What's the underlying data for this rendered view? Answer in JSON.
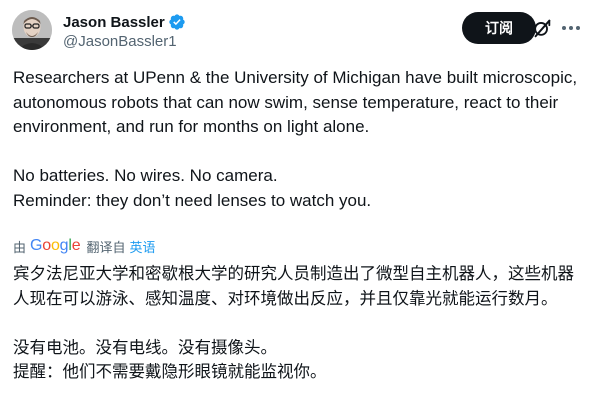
{
  "author": {
    "display_name": "Jason Bassler",
    "handle": "@JasonBassler1",
    "verified": true
  },
  "actions": {
    "subscribe_label": "订阅",
    "grok_icon": "grok-slash-circle-icon",
    "more_icon": "more-dots-icon"
  },
  "tweet": {
    "paragraph_1": "Researchers at UPenn & the University of Michigan have built microscopic, autonomous robots that can now swim, sense temperature, react to their environment, and run for months on light alone.",
    "paragraph_2": "No batteries. No wires. No camera.",
    "paragraph_3": "Reminder: they don’t need lenses to watch you."
  },
  "translation": {
    "by_label": "由",
    "provider": "Google",
    "translated_from": "翻译自",
    "source_language": "英语",
    "paragraph_1": "宾夕法尼亚大学和密歇根大学的研究人员制造出了微型自主机器人，这些机器人现在可以游泳、感知温度、对环境做出反应，并且仅靠光就能运行数月。",
    "paragraph_2": "没有电池。没有电线。没有摄像头。",
    "paragraph_3": "提醒：他们不需要戴隐形眼镜就能监视你。"
  },
  "colors": {
    "text_primary": "#0f1419",
    "text_secondary": "#536471",
    "verified_blue": "#1d9bf0",
    "button_bg": "#0f1419",
    "button_text": "#ffffff"
  }
}
